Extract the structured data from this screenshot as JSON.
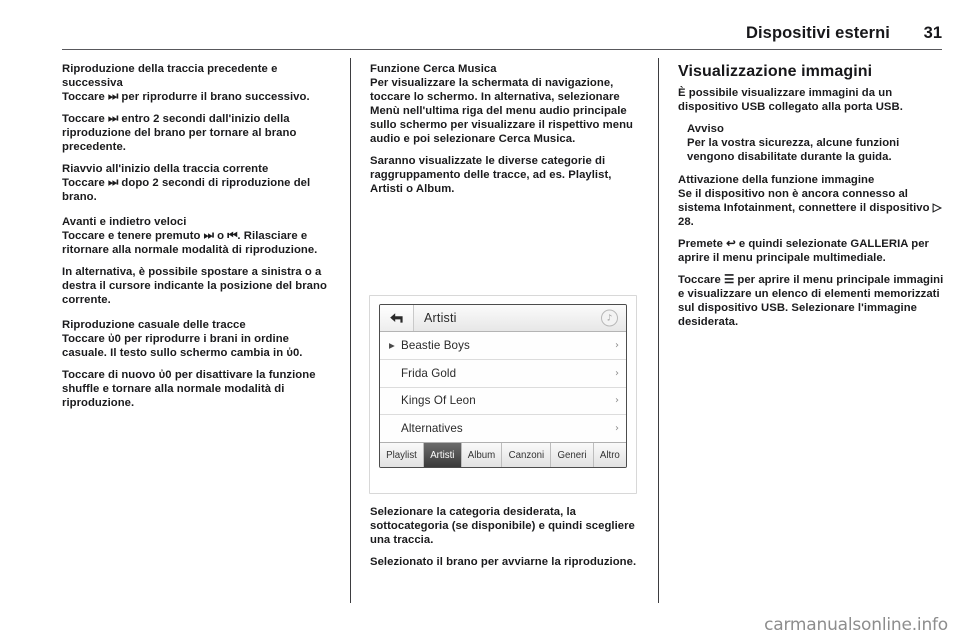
{
  "header": {
    "title": "Dispositivi esterni",
    "page_number": "31"
  },
  "left_column": {
    "heading_1": "Riproduzione della traccia precedente e successiva",
    "para_1": "Toccare ⏭ per riprodurre il brano successivo.",
    "para_2": "Toccare ⏭ entro 2 secondi dall'inizio della riproduzione del brano per tornare al brano precedente.",
    "heading_2": "Riavvio all'inizio della traccia corrente",
    "para_3": "Toccare ⏭ dopo 2 secondi di riproduzione del brano.",
    "heading_3": "Avanti e indietro veloci",
    "para_4": "Toccare e tenere premuto ⏭ o ⏮. Rilasciare e ritornare alla normale modalità di riproduzione.",
    "para_5": "In alternativa, è possibile spostare a sinistra o a destra il cursore indicante la posizione del brano corrente.",
    "heading_4": "Riproduzione casuale delle tracce",
    "para_6": "Toccare ὐ0 per riprodurre i brani in ordine casuale. Il testo sullo schermo cambia in ὐ0.",
    "para_7": "Toccare di nuovo ὐ0 per disattivare la funzione shuffle e tornare alla normale modalità di riproduzione."
  },
  "middle_column": {
    "heading_1": "Funzione Cerca Musica",
    "para_1": "Per visualizzare la schermata di navigazione, toccare lo schermo. In alternativa, selezionare Menù nell'ultima riga del menu audio principale sullo schermo per visualizzare il rispettivo menu audio e poi selezionare Cerca Musica.",
    "para_2": "Saranno visualizzate le diverse categorie di raggruppamento delle tracce, ad es. Playlist, Artisti o Album.",
    "para_3": "Selezionare la categoria desiderata, la sottocategoria (se disponibile) e quindi scegliere una traccia.",
    "para_4": "Selezionato il brano per avviarne la riproduzione."
  },
  "figure_screen": {
    "back_icon": "back-arrow-icon",
    "title": "Artisti",
    "badge_icon": "music-note-icon",
    "rows": [
      {
        "playing_icon": "▶",
        "label": "Beastie Boys",
        "chevron": "›"
      },
      {
        "playing_icon": "",
        "label": "Frida Gold",
        "chevron": "›"
      },
      {
        "playing_icon": "",
        "label": "Kings Of Leon",
        "chevron": "›"
      },
      {
        "playing_icon": "",
        "label": "Alternatives",
        "chevron": "›"
      }
    ],
    "tabs": [
      {
        "label": "Playlist",
        "active": false
      },
      {
        "label": "Artisti",
        "active": true
      },
      {
        "label": "Album",
        "active": false
      },
      {
        "label": "Canzoni",
        "active": false
      },
      {
        "label": "Generi",
        "active": false
      },
      {
        "label": "Altro",
        "active": false
      }
    ]
  },
  "right_column": {
    "section_title": "Visualizzazione immagini",
    "para_1": "È possibile visualizzare immagini da un dispositivo USB collegato alla porta USB.",
    "note_title": "Avviso",
    "note_body": "Per la vostra sicurezza, alcune funzioni vengono disabilitate durante la guida.",
    "heading_1": "Attivazione della funzione immagine",
    "para_2": "Se il dispositivo non è ancora connesso al sistema Infotainment, connettere il dispositivo ▷ 28.",
    "para_3": "Premete ↩ e quindi selezionate GALLERIA per aprire il menu principale multimediale.",
    "para_4": "Toccare ☰ per aprire il menu principale immagini e visualizzare un elenco di elementi memorizzati sul dispositivo USB. Selezionare l'immagine desiderata."
  },
  "watermark": {
    "text": "carmanualsonline.info"
  },
  "colors": {
    "text": "#1b1b1d",
    "rule": "#58585c",
    "tab_active_bg": "#3a3a3a",
    "watermark": "#8d8d8d"
  }
}
